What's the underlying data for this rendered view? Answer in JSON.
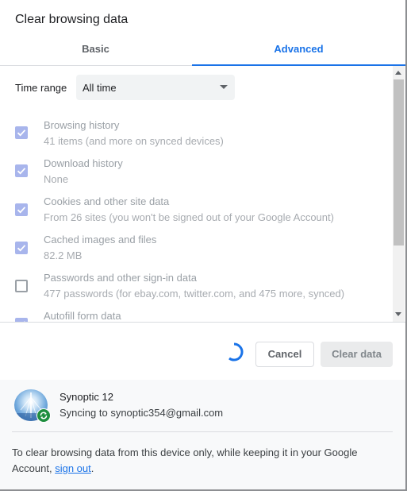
{
  "dialog": {
    "title": "Clear browsing data"
  },
  "tabs": [
    {
      "label": "Basic",
      "selected": false
    },
    {
      "label": "Advanced",
      "selected": true
    }
  ],
  "time_range": {
    "label": "Time range",
    "value": "All time"
  },
  "items": [
    {
      "title": "Browsing history",
      "subtitle": "41 items (and more on synced devices)",
      "checked": true
    },
    {
      "title": "Download history",
      "subtitle": "None",
      "checked": true
    },
    {
      "title": "Cookies and other site data",
      "subtitle": "From 26 sites (you won't be signed out of your Google Account)",
      "checked": true
    },
    {
      "title": "Cached images and files",
      "subtitle": "82.2 MB",
      "checked": true
    },
    {
      "title": "Passwords and other sign-in data",
      "subtitle": "477 passwords (for ebay.com, twitter.com, and 475 more, synced)",
      "checked": false
    },
    {
      "title": "Autofill form data",
      "subtitle": "",
      "checked": true
    }
  ],
  "actions": {
    "cancel_label": "Cancel",
    "clear_label": "Clear data"
  },
  "account": {
    "name": "Synoptic 12",
    "sync_text": "Syncing to synoptic354@gmail.com"
  },
  "footer": {
    "note_prefix": "To clear browsing data from this device only, while keeping it in your Google Account, ",
    "link_label": "sign out",
    "note_suffix": "."
  },
  "colors": {
    "accent": "#1a73e8",
    "checkbox_checked": "#a8b5ec",
    "sync_badge": "#1e8e3e"
  }
}
